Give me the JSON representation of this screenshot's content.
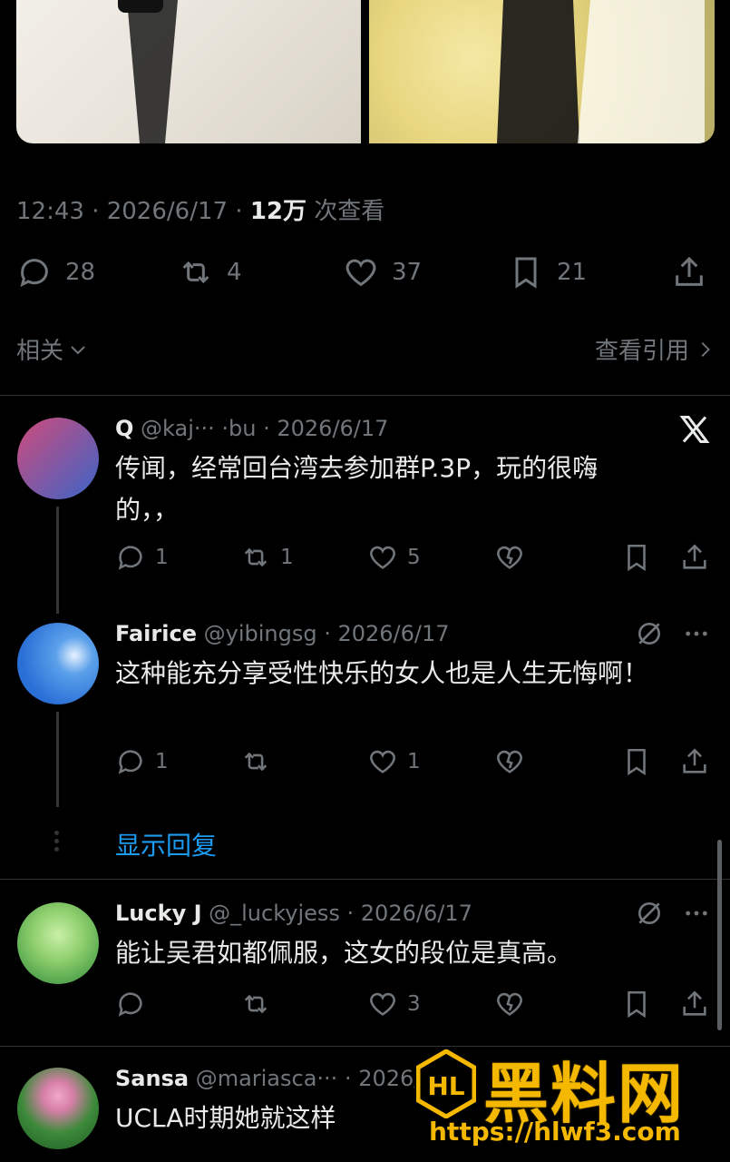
{
  "tweet_meta": {
    "time_date": "12:43 · 2026/6/17 · ",
    "views_count": "12万",
    "views_label": " 次查看"
  },
  "tweet_actions": {
    "replies": "28",
    "reposts": "4",
    "likes": "37",
    "bookmarks": "21"
  },
  "related": {
    "label": "相关",
    "quotes_link": "查看引用"
  },
  "replies": [
    {
      "name": "Q",
      "handle": "@kaj··· ·bu · 2026/6/17",
      "text": "传闻，经常回台湾去参加群P.3P，玩的很嗨的，，",
      "reply_count": "1",
      "repost_count": "1",
      "like_count": "5",
      "top_icon": "x-logo-icon",
      "avatar_colors": [
        "#d14b7a",
        "#3a64c8"
      ]
    },
    {
      "name": "Fairice",
      "handle": "@yibingsg · 2026/6/17",
      "text": "这种能充分享受性快乐的女人也是人生无悔啊！",
      "reply_count": "1",
      "repost_count": "",
      "like_count": "1",
      "top_icon": "grok-icon",
      "avatar_colors": [
        "#2a6fd6",
        "#5aa0ea"
      ]
    },
    {
      "name": "Lucky J",
      "handle": "@_luckyjess · 2026/6/17",
      "text": "能让吴君如都佩服，这女的段位是真高。",
      "reply_count": "",
      "repost_count": "",
      "like_count": "3",
      "top_icon": "grok-icon",
      "avatar_colors": [
        "#8fcf6d",
        "#4da04a"
      ]
    },
    {
      "name": "Sansa",
      "handle": "@mariasca··· · 2026/6/17",
      "text": "UCLA时期她就这样",
      "avatar_colors": [
        "#3c8a3a",
        "#f0a8c8"
      ]
    }
  ],
  "show_replies": "显示回复",
  "watermark": {
    "title": "黑料网",
    "url": "https://hlwf3.com"
  }
}
